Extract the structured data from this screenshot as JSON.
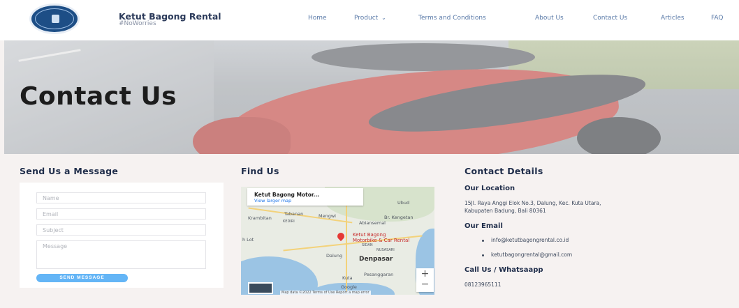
{
  "header": {
    "brand_name": "Ketut Bagong Rental",
    "brand_tag": "#NoWorries",
    "logo_text": "KETUT BAGONG · MOTORBIKE & CAR RENTAL",
    "nav": [
      {
        "label": "Home"
      },
      {
        "label": "Product",
        "has_dropdown": true
      },
      {
        "label": "Terms and Conditions"
      },
      {
        "label": "About Us"
      },
      {
        "label": "Contact Us"
      },
      {
        "label": "Articles"
      },
      {
        "label": "FAQ"
      }
    ]
  },
  "hero": {
    "title": "Contact Us"
  },
  "form": {
    "title": "Send Us a Message",
    "name_placeholder": "Name",
    "email_placeholder": "Email",
    "subject_placeholder": "Subject",
    "message_placeholder": "Message",
    "send_label": "SEND MESSAGE"
  },
  "map": {
    "title": "Find Us",
    "card_title": "Ketut Bagong Motor...",
    "card_link": "View larger map",
    "labels": {
      "ubud": "Ubud",
      "tabanan": "Tabanan",
      "mengwi": "Mengwi",
      "krambitan": "Krambitan",
      "kediri": "KEDIRI",
      "abiansemal": "Abiansemal",
      "br_kengetan": "Br. Kengetan",
      "tanah_lot": "h Lot",
      "pin_line1": "Ketut Bagong",
      "pin_line2": "Motorbike & Car Rental",
      "sidan": "SIDAN",
      "dalung": "Dalung",
      "nusasari": "NUSASARI",
      "denpasar": "Denpasar",
      "kuta": "Kuta",
      "pesanggaran": "Pesanggaran",
      "google": "Google"
    },
    "zoom_in": "+",
    "zoom_out": "−",
    "footer": "Map data ©2022   Terms of Use   Report a map error"
  },
  "contact": {
    "title": "Contact Details",
    "location_title": "Our Location",
    "address_line1": "15Jl. Raya Anggi Elok No.3, Dalung, Kec. Kuta Utara,",
    "address_line2": "Kabupaten Badung, Bali 80361",
    "email_title": "Our Email",
    "emails": [
      "info@ketutbagongrental.co.id",
      "ketutbagongrental@gmail.com"
    ],
    "phone_title": "Call Us / Whatsaapp",
    "phone": "08123965111"
  },
  "colors": {
    "accent": "#64b5f6",
    "heading": "#1f2d4a",
    "nav": "#5a7aa8",
    "background": "#f6f2f1"
  }
}
